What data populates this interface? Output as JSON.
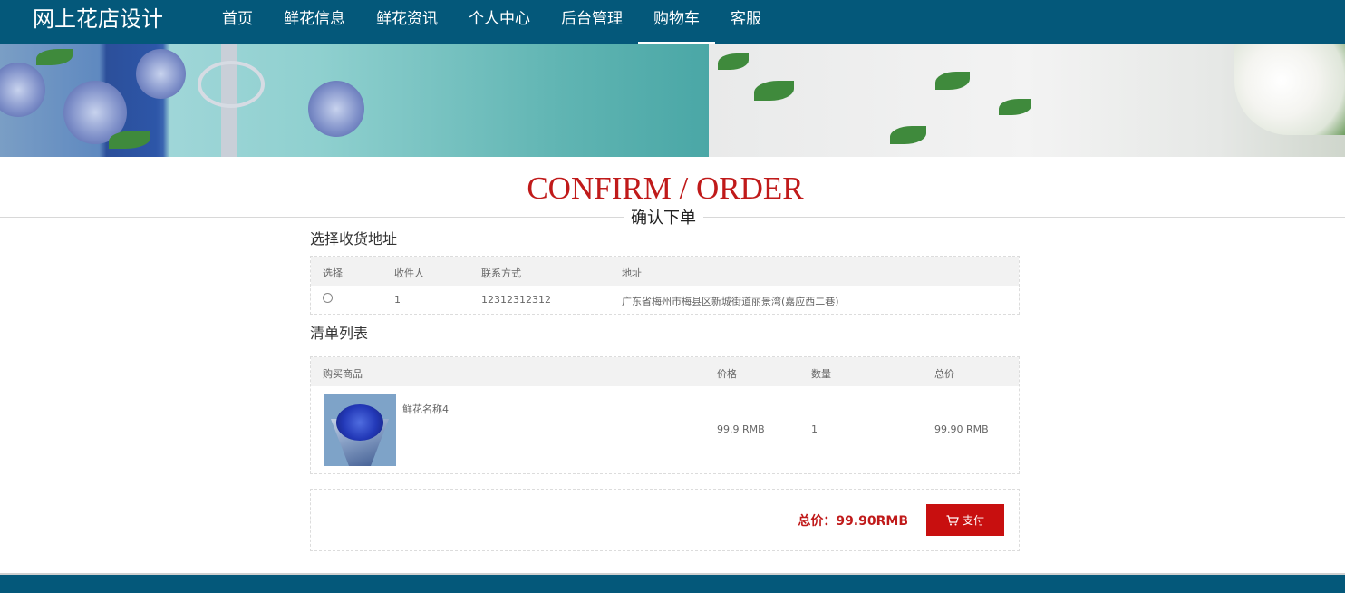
{
  "header": {
    "brand": "网上花店设计",
    "nav": [
      "首页",
      "鲜花信息",
      "鲜花资讯",
      "个人中心",
      "后台管理",
      "购物车",
      "客服"
    ],
    "active_nav": "购物车"
  },
  "heading": {
    "title": "CONFIRM / ORDER",
    "subtitle": "确认下单"
  },
  "address_section": {
    "title": "选择收货地址",
    "columns": [
      "选择",
      "收件人",
      "联系方式",
      "地址"
    ],
    "rows": [
      {
        "recipient": "1",
        "phone": "12312312312",
        "address": "广东省梅州市梅县区新城街道丽景湾(嘉应西二巷)"
      }
    ]
  },
  "list_section": {
    "title": "清单列表",
    "columns": [
      "购买商品",
      "价格",
      "数量",
      "总价"
    ],
    "items": [
      {
        "name": "鲜花名称4",
        "price": "99.9 RMB",
        "quantity": "1",
        "total": "99.90 RMB"
      }
    ]
  },
  "summary": {
    "total_label": "总价：99.90RMB",
    "pay_label": "支付",
    "pay_icon": "cart-icon"
  },
  "colors": {
    "nav_bg": "#04587a",
    "accent_red": "#c01a1a",
    "button_red": "#c80f0f"
  }
}
